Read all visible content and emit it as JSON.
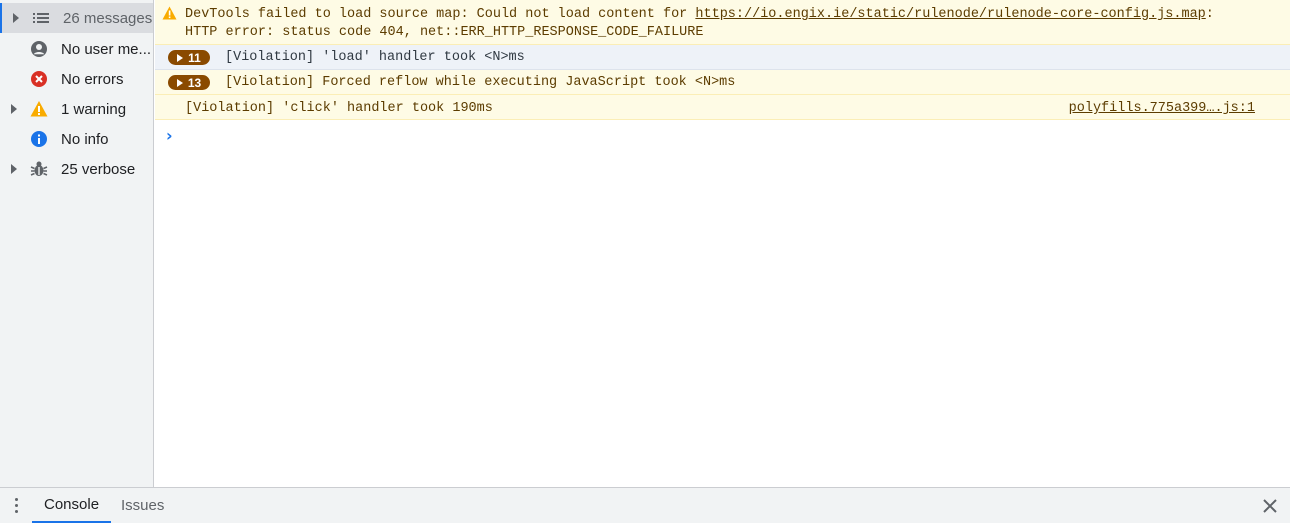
{
  "sidebar": {
    "items": [
      {
        "label": "26 messages",
        "icon": "list-icon",
        "expandable": true,
        "selected": true
      },
      {
        "label": "No user me...",
        "icon": "user-icon",
        "expandable": false
      },
      {
        "label": "No errors",
        "icon": "error-icon",
        "expandable": false
      },
      {
        "label": "1 warning",
        "icon": "warning-icon",
        "expandable": true
      },
      {
        "label": "No info",
        "icon": "info-icon",
        "expandable": false
      },
      {
        "label": "25 verbose",
        "icon": "bug-icon",
        "expandable": true
      }
    ]
  },
  "console": {
    "messages": [
      {
        "level": "warning",
        "line1_text": "DevTools failed to load source map: Could not load content for ",
        "line1_link": "https://io.engix.ie/static/rulenode/rulenode-core-config.js.map",
        "line1_suffix": ":",
        "line2": "HTTP error: status code 404, net::ERR_HTTP_RESPONSE_CODE_FAILURE"
      },
      {
        "level": "verbose",
        "count": "11",
        "text": "[Violation] 'load' handler took <N>ms"
      },
      {
        "level": "verbose",
        "count": "13",
        "text": "[Violation] Forced reflow while executing JavaScript took <N>ms"
      },
      {
        "level": "verbose",
        "text": "[Violation] 'click' handler took 190ms",
        "source": "polyfills.775a399….js:1"
      }
    ],
    "prompt_symbol": "›"
  },
  "drawer": {
    "tabs": [
      {
        "label": "Console",
        "active": true
      },
      {
        "label": "Issues",
        "active": false
      }
    ]
  },
  "colors": {
    "accent": "#1a73e8",
    "warning_bg": "#fefbe5",
    "warning_text": "#5c3c00",
    "badge_bg": "#8a4a00",
    "error_red": "#d93025",
    "warning_yellow": "#f9ab00"
  }
}
